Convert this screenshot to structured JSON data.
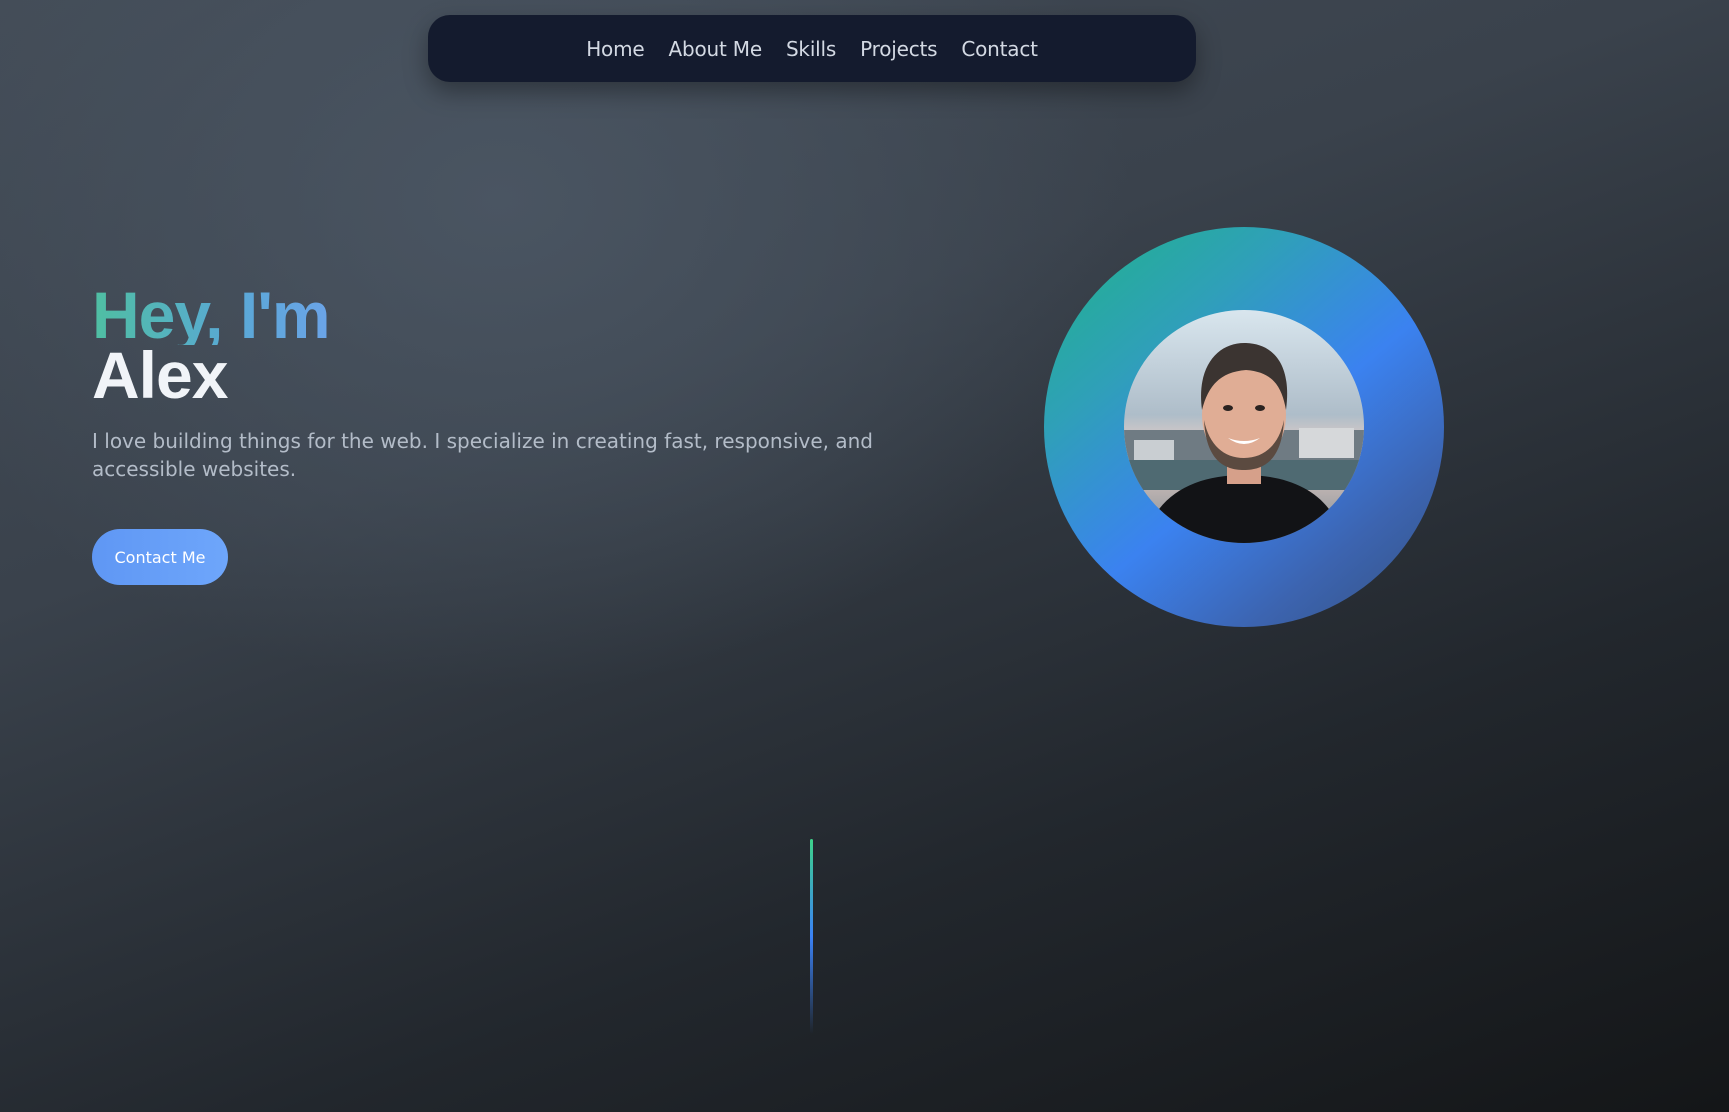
{
  "nav": {
    "items": [
      {
        "label": "Home"
      },
      {
        "label": "About Me"
      },
      {
        "label": "Skills"
      },
      {
        "label": "Projects"
      },
      {
        "label": "Contact"
      }
    ]
  },
  "hero": {
    "greeting": "Hey, I'm",
    "name": "Alex",
    "tagline": "I love building things for the web. I specialize in creating fast, responsive, and accessible websites.",
    "cta_label": "Contact Me"
  },
  "colors": {
    "accent_green": "#1fb488",
    "accent_blue": "#3b82f6",
    "nav_bg": "#141b2e",
    "button_bg": "#6ea6fb"
  },
  "icons": {
    "avatar": "profile-photo",
    "scroll": "scroll-indicator"
  }
}
